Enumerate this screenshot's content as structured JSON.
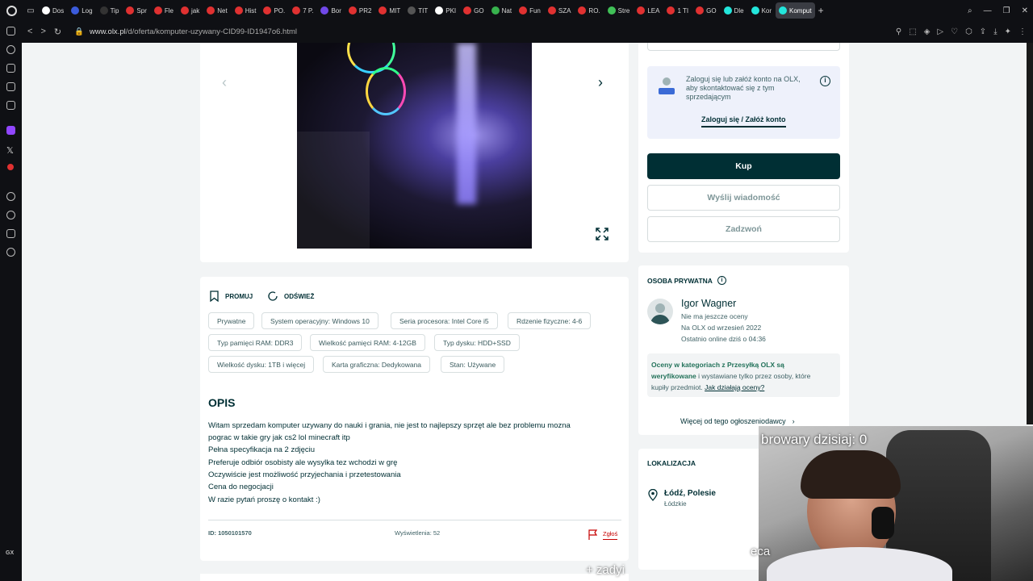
{
  "browser": {
    "tabs": [
      {
        "label": "Dos",
        "color": "#ffffff"
      },
      {
        "label": "Log",
        "color": "#3b5bdb"
      },
      {
        "label": "Tip",
        "color": "#333333"
      },
      {
        "label": "Spr",
        "color": "#e03131"
      },
      {
        "label": "Fle",
        "color": "#e03131"
      },
      {
        "label": "jak",
        "color": "#e03131"
      },
      {
        "label": "Net",
        "color": "#e03131"
      },
      {
        "label": "Hist",
        "color": "#e03131"
      },
      {
        "label": "PO.",
        "color": "#e03131"
      },
      {
        "label": "7 P.",
        "color": "#e03131"
      },
      {
        "label": "Bor",
        "color": "#7048e8"
      },
      {
        "label": "PR2",
        "color": "#e03131"
      },
      {
        "label": "MIT",
        "color": "#e03131"
      },
      {
        "label": "TIT",
        "color": "#555555"
      },
      {
        "label": "PKI",
        "color": "#ffffff"
      },
      {
        "label": "GO",
        "color": "#e03131"
      },
      {
        "label": "Nat",
        "color": "#37b24d"
      },
      {
        "label": "Fun",
        "color": "#e03131"
      },
      {
        "label": "SZA",
        "color": "#e03131"
      },
      {
        "label": "RO.",
        "color": "#e03131"
      },
      {
        "label": "Stre",
        "color": "#40c057"
      },
      {
        "label": "LEA",
        "color": "#e03131"
      },
      {
        "label": "1 TI",
        "color": "#e03131"
      },
      {
        "label": "GO",
        "color": "#e03131"
      },
      {
        "label": "Dle",
        "color": "#23e5db"
      },
      {
        "label": "Kor",
        "color": "#23e5db"
      },
      {
        "label": "Komput",
        "color": "#23e5db",
        "active": true
      }
    ],
    "url_host": "www.olx.pl",
    "url_path": "/d/oferta/komputer-uzywany-CID99-ID1947o6.html",
    "sidebar_bottom": "GX"
  },
  "login_box": {
    "text": "Zaloguj się lub załóż konto na OLX, aby skontaktować się z tym sprzedającym",
    "link": "Zaloguj się / Załóż konto"
  },
  "buttons": {
    "buy": "Kup",
    "message": "Wyślij wiadomość",
    "call": "Zadzwoń"
  },
  "actions": {
    "promote": "PROMUJ",
    "refresh": "ODŚWIEŻ"
  },
  "tags": [
    "Prywatne",
    "System operacyjny: Windows 10",
    "Seria procesora: Intel Core i5",
    "Rdzenie fizyczne: 4-6",
    "Typ pamięci RAM: DDR3",
    "Wielkość pamięci RAM: 4-12GB",
    "Typ dysku: HDD+SSD",
    "Wielkość dysku: 1TB i więcej",
    "Karta graficzna: Dedykowana",
    "Stan: Używane"
  ],
  "description": {
    "heading": "OPIS",
    "lines": [
      "Witam sprzedam komputer uzywany do nauki i grania, nie jest to najlepszy sprzęt ale bez problemu mozna",
      "pograc w takie gry jak cs2 lol minecraft itp",
      "Pełna specyfikacja na 2 zdjęciu",
      "Preferuje odbiór osobisty ale wysylka tez wchodzi w grę",
      "Oczywiście jest możliwość przyjechania i przetestowania",
      "Cena do negocjacji",
      "W razie pytań proszę o kontakt :)"
    ]
  },
  "footer": {
    "id": "ID: 1050101570",
    "views": "Wyświetlenia: 52",
    "report": "Zgłoś"
  },
  "seller": {
    "section": "OSOBA PRYWATNA",
    "name": "Igor Wagner",
    "rating": "Nie ma jeszcze oceny",
    "since": "Na OLX od wrzesień 2022",
    "online": "Ostatnio online dziś o 04:36",
    "info_bold_1": "Oceny w kategoriach z Przesyłką OLX są",
    "info_bold_2": "weryfikowane",
    "info_rest_1": " i wystawiane tylko przez osoby, które",
    "info_rest_2": "kupiły przedmiot. ",
    "info_link": "Jak działają oceny?",
    "more": "Więcej od tego ogłoszeniodawcy"
  },
  "location": {
    "section": "LOKALIZACJA",
    "city": "Łódź, Polesie",
    "region": "Łódzkie"
  },
  "overlay": {
    "counter": "browary dzisiaj: 0",
    "sub1": "eca",
    "sub2": "+ zadyi"
  }
}
